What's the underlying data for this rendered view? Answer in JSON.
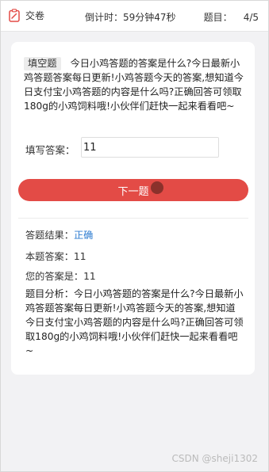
{
  "topbar": {
    "submit_label": "交卷",
    "timer_label": "倒计时：",
    "timer_value": "59分钟47秒",
    "question_label": "题目：",
    "question_progress": "4/5"
  },
  "question": {
    "type_tag": "填空题",
    "text": "今日小鸡答题的答案是什么?今日最新小鸡答题答案每日更新!小鸡答题今天的答案,想知道今日支付宝小鸡答题的内容是什么吗?正确回答可领取180g的小鸡饲料哦!小伙伴们赶快一起来看看吧~"
  },
  "answer": {
    "label": "填写答案：",
    "value": "11"
  },
  "next_button": {
    "label": "下一题"
  },
  "result": {
    "result_label": "答题结果：",
    "result_value": "正确",
    "correct_answer": "本题答案：11",
    "your_answer": "您的答案是：11",
    "analysis_label": "题目分析：",
    "analysis_text": "今日小鸡答题的答案是什么?今日最新小鸡答题答案每日更新!小鸡答题今天的答案,想知道今日支付宝小鸡答题的内容是什么吗?正确回答可领取180g的小鸡饲料哦!小伙伴们赶快一起来看看吧~"
  },
  "watermark": "CSDN @sheji1302",
  "colors": {
    "accent": "#e34b46",
    "result_correct": "#2f7dd1",
    "background": "#f2f2f4"
  },
  "icons": {
    "submit": "clipboard-icon"
  }
}
